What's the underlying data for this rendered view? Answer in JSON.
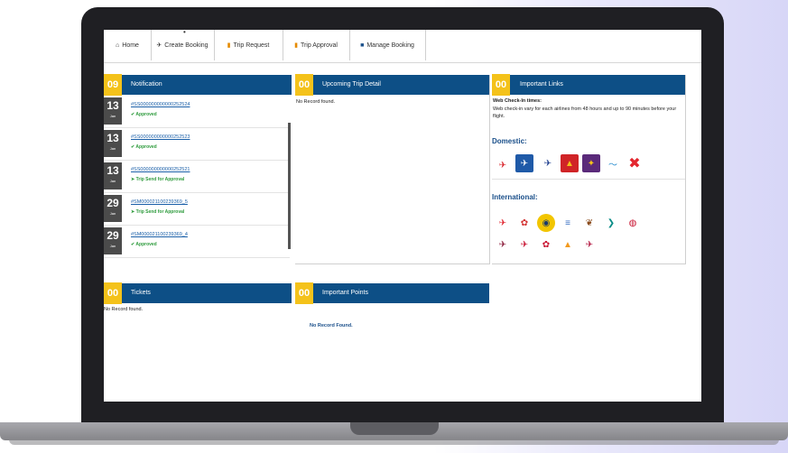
{
  "nav": {
    "tabs": [
      {
        "label": "Home",
        "icon": "home-icon"
      },
      {
        "label": "Create Booking",
        "icon": "plane-icon"
      },
      {
        "label": "Trip Request",
        "icon": "document-icon"
      },
      {
        "label": "Trip Approval",
        "icon": "document-icon"
      },
      {
        "label": "Manage Booking",
        "icon": "briefcase-icon"
      }
    ]
  },
  "notification": {
    "count": "09",
    "title": "Notification",
    "items": [
      {
        "day": "13",
        "month": "Jan",
        "ref": "#SS000000000000252524",
        "status": "Approved"
      },
      {
        "day": "13",
        "month": "Jan",
        "ref": "#SS000000000000252523",
        "status": "Approved"
      },
      {
        "day": "13",
        "month": "Jan",
        "ref": "#SS000000000000252521",
        "status": "Trip Send for Approval"
      },
      {
        "day": "29",
        "month": "Jan",
        "ref": "#SM000021100239369_5",
        "status": "Trip Send for Approval"
      },
      {
        "day": "29",
        "month": "Jan",
        "ref": "#SM000021100239369_4",
        "status": "Approved"
      }
    ]
  },
  "upcoming": {
    "count": "00",
    "title": "Upcoming Trip Detail",
    "empty": "No Record found."
  },
  "links": {
    "count": "00",
    "title": "Important Links",
    "checkin_title": "Web Check-In times:",
    "checkin_text": "Web check-in vary for each airlines from 48 hours and up to 90 minutes before your flight.",
    "domestic_label": "Domestic:",
    "international_label": "International:",
    "colors": {
      "domestic": [
        "#d9262c",
        "#1f5aa8",
        "#1f3f8f",
        "#d02427",
        "#5a2a7a",
        "#2b8ecf",
        "#e3262e"
      ],
      "international": [
        "#e0262f",
        "#d32f2f",
        "#f2c500",
        "#3a6fc3",
        "#8a4b1c",
        "#0a8d87",
        "#c8102e",
        "#8b1d3b",
        "#c8102e",
        "#c8102e",
        "#f29a1f",
        "#b31942"
      ]
    }
  },
  "tickets": {
    "count": "00",
    "title": "Tickets",
    "empty": "No Record found."
  },
  "points": {
    "count": "00",
    "title": "Important Points",
    "empty": "No Record Found."
  }
}
